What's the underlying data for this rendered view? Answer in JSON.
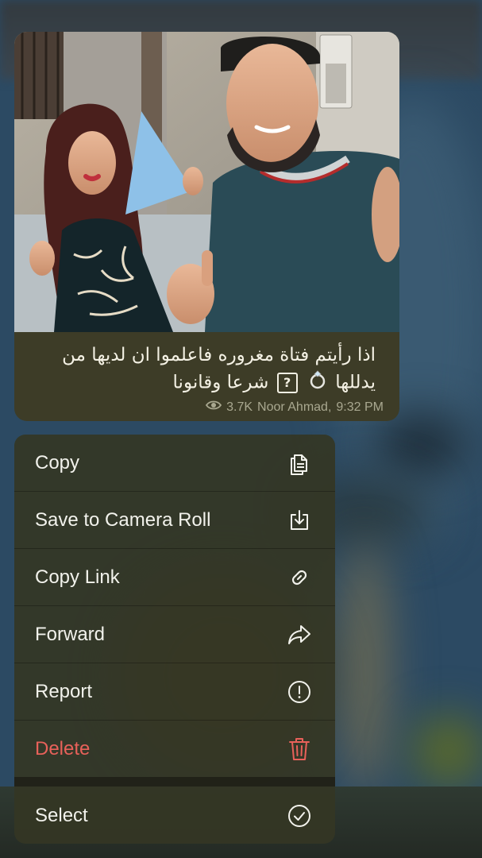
{
  "message": {
    "caption_line1": "اذا رأيتم فتاة مغروره فاعلموا ان لديها من",
    "caption_line2_a": "يدللها",
    "caption_line2_box": "?",
    "caption_line2_b": "شرعا وقانونا",
    "views": "3.7K",
    "author": "Noor Ahmad",
    "time": "9:32 PM",
    "views_icon": "eye-icon"
  },
  "menu": {
    "items": [
      {
        "label": "Copy",
        "icon": "copy-icon"
      },
      {
        "label": "Save to Camera Roll",
        "icon": "download-icon"
      },
      {
        "label": "Copy Link",
        "icon": "link-icon"
      },
      {
        "label": "Forward",
        "icon": "forward-icon"
      },
      {
        "label": "Report",
        "icon": "report-icon"
      },
      {
        "label": "Delete",
        "icon": "trash-icon",
        "color": "#e8615a"
      },
      {
        "label": "Select",
        "icon": "checkmark-circle-icon"
      }
    ]
  },
  "colors": {
    "menu_text": "#f2f2ec",
    "destructive": "#e8615a",
    "bubble_bg": "#3d3c27",
    "chat_bg": "#2c4a63"
  }
}
